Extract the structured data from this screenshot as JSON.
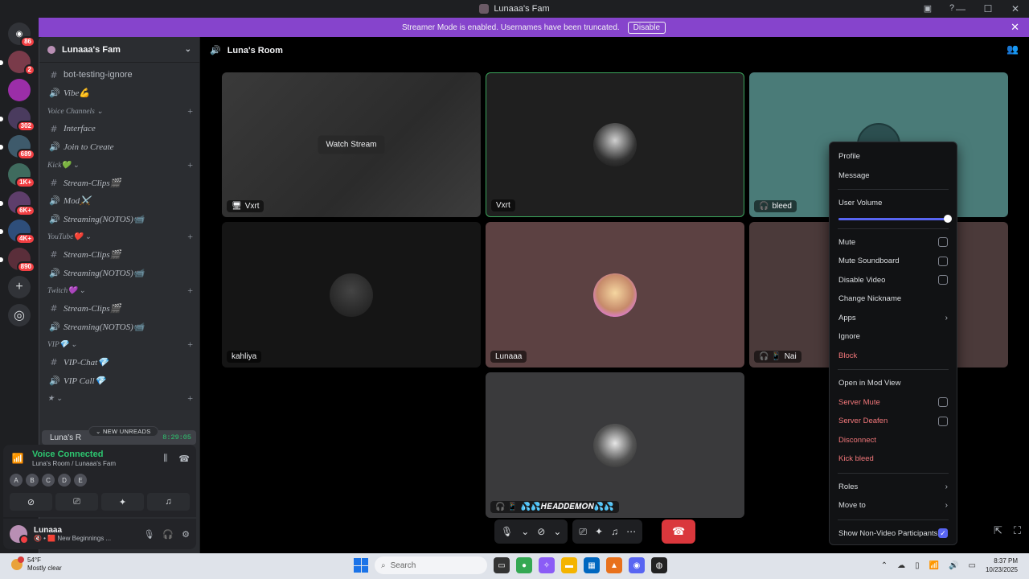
{
  "window": {
    "title": "Lunaaa's Fam",
    "controls": {
      "minimize": "—",
      "maximize": "☐",
      "close": "✕"
    }
  },
  "servers": [
    {
      "icon": "discord-home-icon",
      "badge": "86"
    },
    {
      "icon": "server-icon",
      "badge": "2"
    },
    {
      "icon": "server-icon",
      "badge": ""
    },
    {
      "icon": "server-icon",
      "badge": "302"
    },
    {
      "icon": "server-icon",
      "badge": "689"
    },
    {
      "icon": "server-icon",
      "badge": "1K+"
    },
    {
      "icon": "server-icon",
      "badge": "6K+"
    },
    {
      "icon": "server-icon",
      "badge": "4K+"
    },
    {
      "icon": "server-icon",
      "badge": "890"
    }
  ],
  "banner": {
    "text": "Streamer Mode is enabled. Usernames have been truncated.",
    "button": "Disable"
  },
  "sidebar": {
    "server_name": "Lunaaa's Fam",
    "items": [
      {
        "kind": "channel",
        "icon": "#",
        "label": "bot-testing-ignore",
        "plain": true
      },
      {
        "kind": "channel",
        "icon": "🔊",
        "label": "Vibe💪"
      },
      {
        "kind": "category",
        "label": "Voice Channels ⌄"
      },
      {
        "kind": "channel",
        "icon": "#",
        "label": "Interface"
      },
      {
        "kind": "channel",
        "icon": "🔊",
        "label": "Join to Create"
      },
      {
        "kind": "category",
        "label": "Kick💚 ⌄"
      },
      {
        "kind": "channel",
        "icon": "#",
        "label": "Stream-Clips🎬"
      },
      {
        "kind": "channel",
        "icon": "🔊",
        "label": "Mod⚔️"
      },
      {
        "kind": "channel",
        "icon": "🔊",
        "label": "Streaming(NOTOS)📹"
      },
      {
        "kind": "category",
        "label": "YouTube❤️ ⌄"
      },
      {
        "kind": "channel",
        "icon": "#",
        "label": "Stream-Clips🎬"
      },
      {
        "kind": "channel",
        "icon": "🔊",
        "label": "Streaming(NOTOS)📹"
      },
      {
        "kind": "category",
        "label": "Twitch💜 ⌄"
      },
      {
        "kind": "channel",
        "icon": "#",
        "label": "Stream-Clips🎬"
      },
      {
        "kind": "channel",
        "icon": "🔊",
        "label": "Streaming(NOTOS)📹"
      },
      {
        "kind": "category",
        "label": "VIP💎 ⌄"
      },
      {
        "kind": "channel",
        "icon": "#",
        "label": "VIP-Chat💎"
      },
      {
        "kind": "channel",
        "icon": "🔊",
        "label": "VIP Call💎"
      },
      {
        "kind": "category",
        "label": "★ ⌄"
      }
    ],
    "unreads_label": "⌄ NEW UNREADS",
    "active_channel": {
      "label": "Luna's R",
      "timer": "8:29:05"
    }
  },
  "voice": {
    "status": "Voice Connected",
    "location": "Luna's Room / Lunaaa's Fam",
    "participants": [
      "A",
      "B",
      "C",
      "D",
      "E"
    ]
  },
  "user": {
    "name": "Lunaaa",
    "status": "🔇 • 🟥 New Beginnings ..."
  },
  "room": {
    "title": "Luna's Room",
    "tiles": [
      {
        "id": "t1",
        "name": "Vxrt",
        "prefix": "🖥",
        "watch": "Watch Stream"
      },
      {
        "id": "t2",
        "name": "Vxrt",
        "prefix": ""
      },
      {
        "id": "t3",
        "name": "bleed",
        "prefix": "🎧"
      },
      {
        "id": "t4",
        "name": "kahliya",
        "prefix": ""
      },
      {
        "id": "t5",
        "name": "Lunaaa",
        "prefix": ""
      },
      {
        "id": "t6",
        "name": "Nai",
        "prefix": "🎧 📱"
      },
      {
        "id": "t7",
        "name": "💦💦𝑯𝑬𝑨𝑫𝑫𝑬𝑴𝑶𝑵💦💦",
        "prefix": "🎧 📱"
      }
    ]
  },
  "context_menu": {
    "profile": "Profile",
    "message": "Message",
    "user_volume": "User Volume",
    "user_volume_level": 1.0,
    "mute": "Mute",
    "mute_soundboard": "Mute Soundboard",
    "disable_video": "Disable Video",
    "change_nickname": "Change Nickname",
    "apps": "Apps",
    "ignore": "Ignore",
    "block": "Block",
    "open_mod_view": "Open in Mod View",
    "server_mute": "Server Mute",
    "server_deafen": "Server Deafen",
    "disconnect": "Disconnect",
    "kick": "Kick bleed",
    "roles": "Roles",
    "move_to": "Move to",
    "show_non_video": "Show Non-Video Participants"
  },
  "taskbar": {
    "weather_temp": "54°F",
    "weather_desc": "Mostly clear",
    "search_placeholder": "Search",
    "time": "8:37 PM",
    "date": "10/23/2025"
  },
  "colors": {
    "banner": "#8644cc",
    "accent": "#5865f2",
    "online": "#2dc770",
    "danger": "#f2777a"
  }
}
